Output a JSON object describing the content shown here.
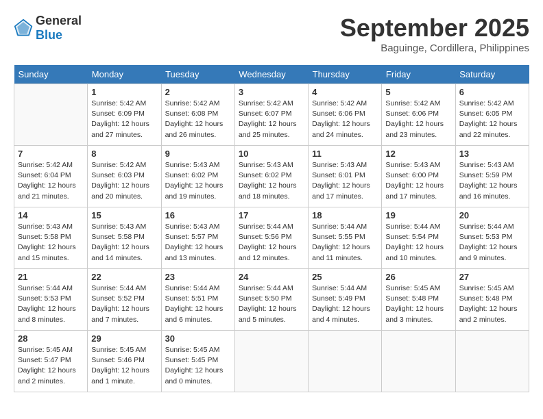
{
  "header": {
    "logo": {
      "general": "General",
      "blue": "Blue"
    },
    "month": "September 2025",
    "location": "Baguinge, Cordillera, Philippines"
  },
  "days_of_week": [
    "Sunday",
    "Monday",
    "Tuesday",
    "Wednesday",
    "Thursday",
    "Friday",
    "Saturday"
  ],
  "weeks": [
    [
      {
        "day": "",
        "info": ""
      },
      {
        "day": "1",
        "info": "Sunrise: 5:42 AM\nSunset: 6:09 PM\nDaylight: 12 hours\nand 27 minutes."
      },
      {
        "day": "2",
        "info": "Sunrise: 5:42 AM\nSunset: 6:08 PM\nDaylight: 12 hours\nand 26 minutes."
      },
      {
        "day": "3",
        "info": "Sunrise: 5:42 AM\nSunset: 6:07 PM\nDaylight: 12 hours\nand 25 minutes."
      },
      {
        "day": "4",
        "info": "Sunrise: 5:42 AM\nSunset: 6:06 PM\nDaylight: 12 hours\nand 24 minutes."
      },
      {
        "day": "5",
        "info": "Sunrise: 5:42 AM\nSunset: 6:06 PM\nDaylight: 12 hours\nand 23 minutes."
      },
      {
        "day": "6",
        "info": "Sunrise: 5:42 AM\nSunset: 6:05 PM\nDaylight: 12 hours\nand 22 minutes."
      }
    ],
    [
      {
        "day": "7",
        "info": "Sunrise: 5:42 AM\nSunset: 6:04 PM\nDaylight: 12 hours\nand 21 minutes."
      },
      {
        "day": "8",
        "info": "Sunrise: 5:42 AM\nSunset: 6:03 PM\nDaylight: 12 hours\nand 20 minutes."
      },
      {
        "day": "9",
        "info": "Sunrise: 5:43 AM\nSunset: 6:02 PM\nDaylight: 12 hours\nand 19 minutes."
      },
      {
        "day": "10",
        "info": "Sunrise: 5:43 AM\nSunset: 6:02 PM\nDaylight: 12 hours\nand 18 minutes."
      },
      {
        "day": "11",
        "info": "Sunrise: 5:43 AM\nSunset: 6:01 PM\nDaylight: 12 hours\nand 17 minutes."
      },
      {
        "day": "12",
        "info": "Sunrise: 5:43 AM\nSunset: 6:00 PM\nDaylight: 12 hours\nand 17 minutes."
      },
      {
        "day": "13",
        "info": "Sunrise: 5:43 AM\nSunset: 5:59 PM\nDaylight: 12 hours\nand 16 minutes."
      }
    ],
    [
      {
        "day": "14",
        "info": "Sunrise: 5:43 AM\nSunset: 5:58 PM\nDaylight: 12 hours\nand 15 minutes."
      },
      {
        "day": "15",
        "info": "Sunrise: 5:43 AM\nSunset: 5:58 PM\nDaylight: 12 hours\nand 14 minutes."
      },
      {
        "day": "16",
        "info": "Sunrise: 5:43 AM\nSunset: 5:57 PM\nDaylight: 12 hours\nand 13 minutes."
      },
      {
        "day": "17",
        "info": "Sunrise: 5:44 AM\nSunset: 5:56 PM\nDaylight: 12 hours\nand 12 minutes."
      },
      {
        "day": "18",
        "info": "Sunrise: 5:44 AM\nSunset: 5:55 PM\nDaylight: 12 hours\nand 11 minutes."
      },
      {
        "day": "19",
        "info": "Sunrise: 5:44 AM\nSunset: 5:54 PM\nDaylight: 12 hours\nand 10 minutes."
      },
      {
        "day": "20",
        "info": "Sunrise: 5:44 AM\nSunset: 5:53 PM\nDaylight: 12 hours\nand 9 minutes."
      }
    ],
    [
      {
        "day": "21",
        "info": "Sunrise: 5:44 AM\nSunset: 5:53 PM\nDaylight: 12 hours\nand 8 minutes."
      },
      {
        "day": "22",
        "info": "Sunrise: 5:44 AM\nSunset: 5:52 PM\nDaylight: 12 hours\nand 7 minutes."
      },
      {
        "day": "23",
        "info": "Sunrise: 5:44 AM\nSunset: 5:51 PM\nDaylight: 12 hours\nand 6 minutes."
      },
      {
        "day": "24",
        "info": "Sunrise: 5:44 AM\nSunset: 5:50 PM\nDaylight: 12 hours\nand 5 minutes."
      },
      {
        "day": "25",
        "info": "Sunrise: 5:44 AM\nSunset: 5:49 PM\nDaylight: 12 hours\nand 4 minutes."
      },
      {
        "day": "26",
        "info": "Sunrise: 5:45 AM\nSunset: 5:48 PM\nDaylight: 12 hours\nand 3 minutes."
      },
      {
        "day": "27",
        "info": "Sunrise: 5:45 AM\nSunset: 5:48 PM\nDaylight: 12 hours\nand 2 minutes."
      }
    ],
    [
      {
        "day": "28",
        "info": "Sunrise: 5:45 AM\nSunset: 5:47 PM\nDaylight: 12 hours\nand 2 minutes."
      },
      {
        "day": "29",
        "info": "Sunrise: 5:45 AM\nSunset: 5:46 PM\nDaylight: 12 hours\nand 1 minute."
      },
      {
        "day": "30",
        "info": "Sunrise: 5:45 AM\nSunset: 5:45 PM\nDaylight: 12 hours\nand 0 minutes."
      },
      {
        "day": "",
        "info": ""
      },
      {
        "day": "",
        "info": ""
      },
      {
        "day": "",
        "info": ""
      },
      {
        "day": "",
        "info": ""
      }
    ]
  ]
}
